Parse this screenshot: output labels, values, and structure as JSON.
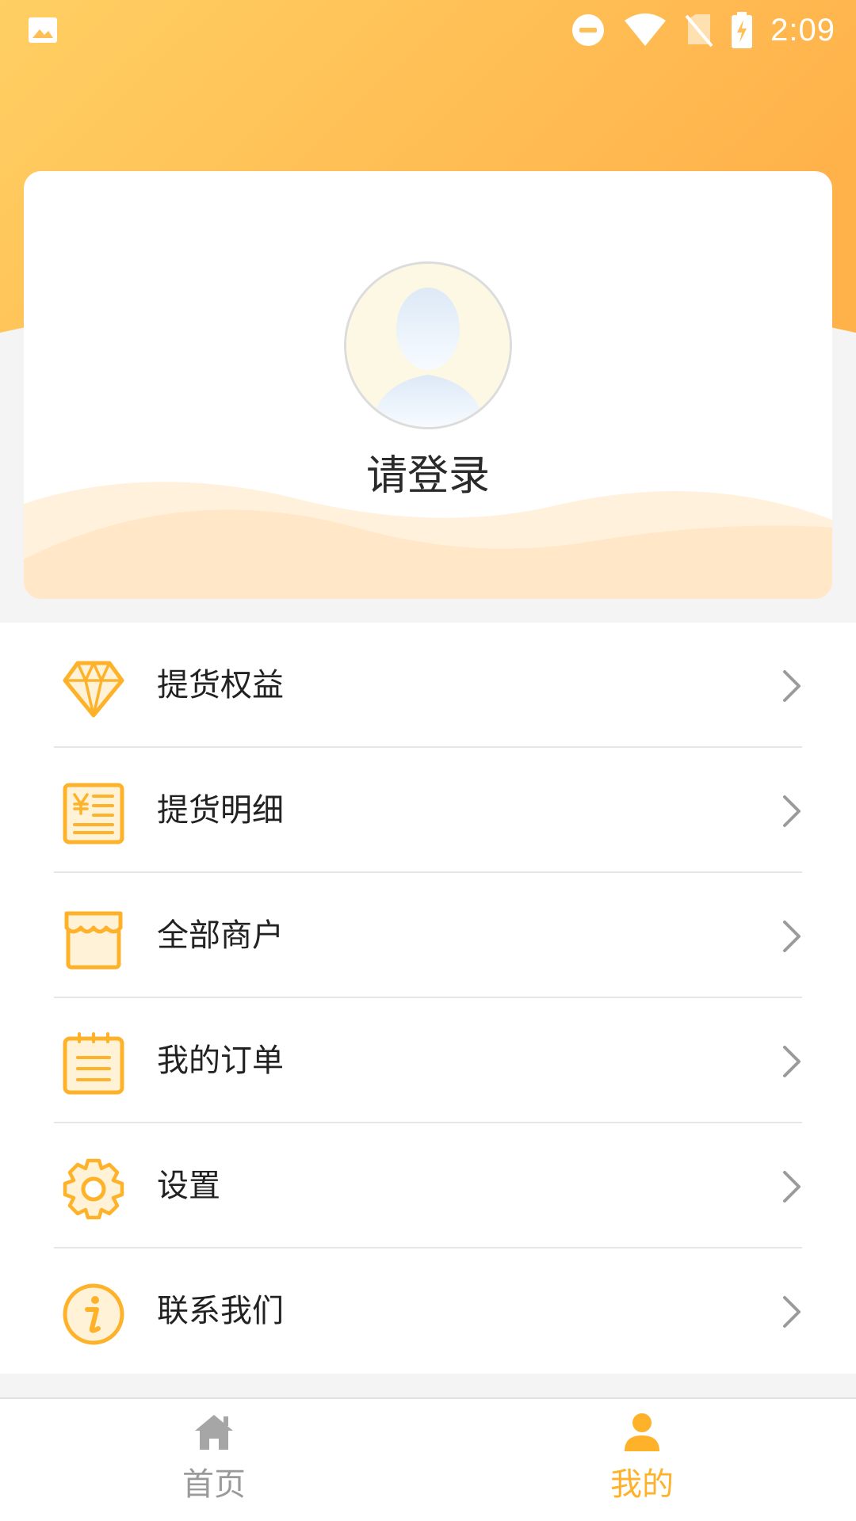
{
  "status_bar": {
    "time": "2:09",
    "icons": [
      "image-notification-icon",
      "do-not-disturb-icon",
      "wifi-icon",
      "no-sim-icon",
      "battery-charging-icon"
    ]
  },
  "profile": {
    "login_prompt": "请登录",
    "avatar_icon": "default-avatar-icon"
  },
  "menu": {
    "items": [
      {
        "label": "提货权益",
        "icon": "diamond-icon"
      },
      {
        "label": "提货明细",
        "icon": "yen-receipt-icon"
      },
      {
        "label": "全部商户",
        "icon": "store-icon"
      },
      {
        "label": "我的订单",
        "icon": "order-list-icon"
      },
      {
        "label": "设置",
        "icon": "gear-icon"
      },
      {
        "label": "联系我们",
        "icon": "info-icon"
      }
    ]
  },
  "bottom_nav": {
    "items": [
      {
        "label": "首页",
        "icon": "home-icon",
        "active": false
      },
      {
        "label": "我的",
        "icon": "user-icon",
        "active": true
      }
    ]
  },
  "colors": {
    "accent": "#fdb22a",
    "accent_light": "#ffc965",
    "inactive_nav": "#9a9a9a",
    "text": "#222222"
  }
}
